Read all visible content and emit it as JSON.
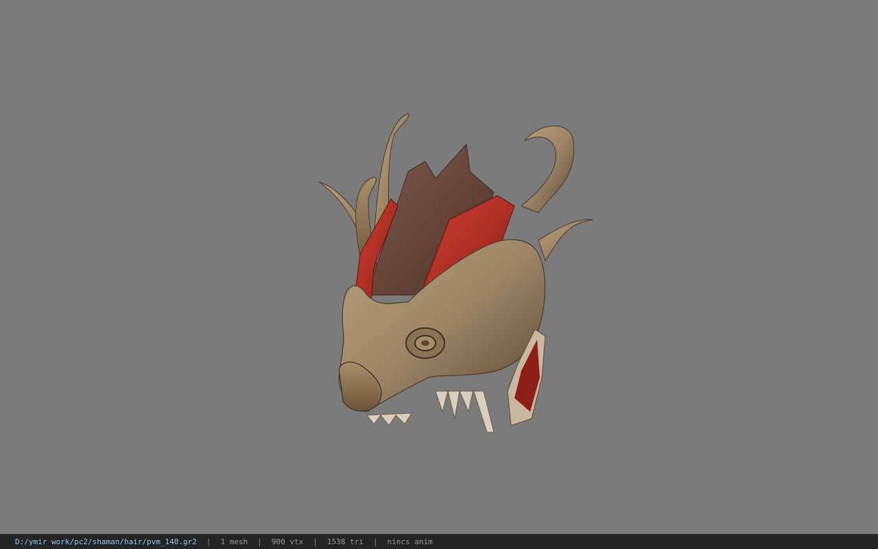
{
  "viewport": {
    "background": "#7b7b7b",
    "model": {
      "description": "dragon head helmet",
      "icon": "dragon-helmet-model",
      "colors": {
        "bronze": "#9c8566",
        "bronze_dark": "#5a4631",
        "red": "#b82c22",
        "crest": "#6b4a3e"
      }
    }
  },
  "status_bar": {
    "path": "D:/ymir work/pc2/shaman/hair/pvm_140.gr2",
    "separator": "|",
    "mesh": "1 mesh",
    "vtx": "900 vtx",
    "tri": "1538 tri",
    "anim": "nincs anim",
    "path_color": "#9ec7ea",
    "text_color": "#9a9a9a"
  }
}
